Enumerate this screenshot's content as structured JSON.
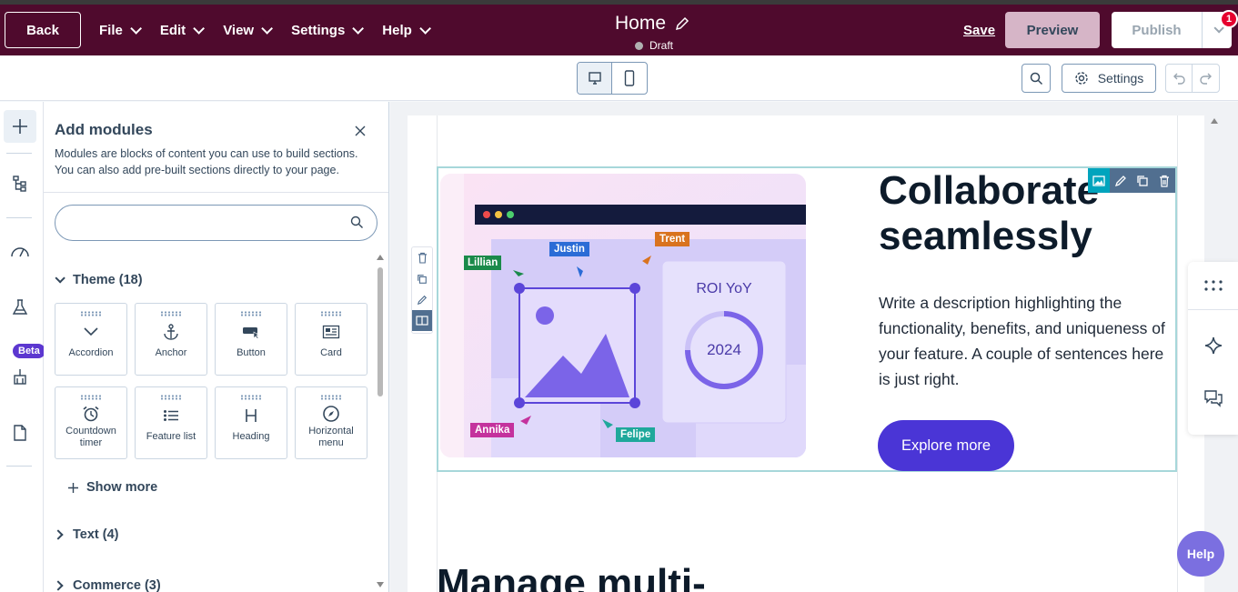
{
  "topbar": {
    "back_label": "Back",
    "menu": [
      {
        "label": "File"
      },
      {
        "label": "Edit"
      },
      {
        "label": "View"
      },
      {
        "label": "Settings"
      },
      {
        "label": "Help"
      }
    ],
    "page_title": "Home",
    "status": "Draft",
    "save_label": "Save",
    "preview_label": "Preview",
    "publish_label": "Publish",
    "notification_count": "1",
    "bg_color": "#4f0a2d"
  },
  "toolbar": {
    "settings_label": "Settings",
    "device_active": "desktop"
  },
  "rail": {
    "items": [
      "add-icon",
      "tree-icon",
      "gauge-icon",
      "flask-icon",
      "brush-icon",
      "page-icon"
    ],
    "beta_label": "Beta"
  },
  "panel": {
    "title": "Add modules",
    "description": "Modules are blocks of content you can use to build sections. You can also add pre-built sections directly to your page.",
    "search_placeholder": "",
    "categories": [
      {
        "label": "Theme (18)",
        "expanded": true
      },
      {
        "label": "Text (4)",
        "expanded": false
      },
      {
        "label": "Commerce (3)",
        "expanded": false
      }
    ],
    "modules": [
      {
        "label": "Accordion",
        "icon": "chevron-down-icon"
      },
      {
        "label": "Anchor",
        "icon": "anchor-icon"
      },
      {
        "label": "Button",
        "icon": "button-icon"
      },
      {
        "label": "Card",
        "icon": "card-icon"
      },
      {
        "label": "Countdown timer",
        "icon": "alarm-icon"
      },
      {
        "label": "Feature list",
        "icon": "list-icon"
      },
      {
        "label": "Heading",
        "icon": "heading-icon"
      },
      {
        "label": "Horizontal menu",
        "icon": "compass-icon"
      }
    ],
    "show_more_label": "Show more"
  },
  "canvas": {
    "hero": {
      "heading": "Collaborate seamlessly",
      "description": "Write a description highlighting the functionality, benefits, and uniqueness of your feature. A couple of sentences here is just right.",
      "button_label": "Explore more",
      "button_color": "#4a35d6",
      "illustration": {
        "card_title": "ROI YoY",
        "card_value": "2024",
        "tags": [
          {
            "name": "Lillian",
            "color": "#1a8a4a"
          },
          {
            "name": "Justin",
            "color": "#2b6cd6"
          },
          {
            "name": "Trent",
            "color": "#d9731f"
          },
          {
            "name": "Annika",
            "color": "#c4329d"
          },
          {
            "name": "Felipe",
            "color": "#1fa89b"
          }
        ]
      }
    },
    "next_heading": "Manage multi-"
  },
  "help_label": "Help"
}
